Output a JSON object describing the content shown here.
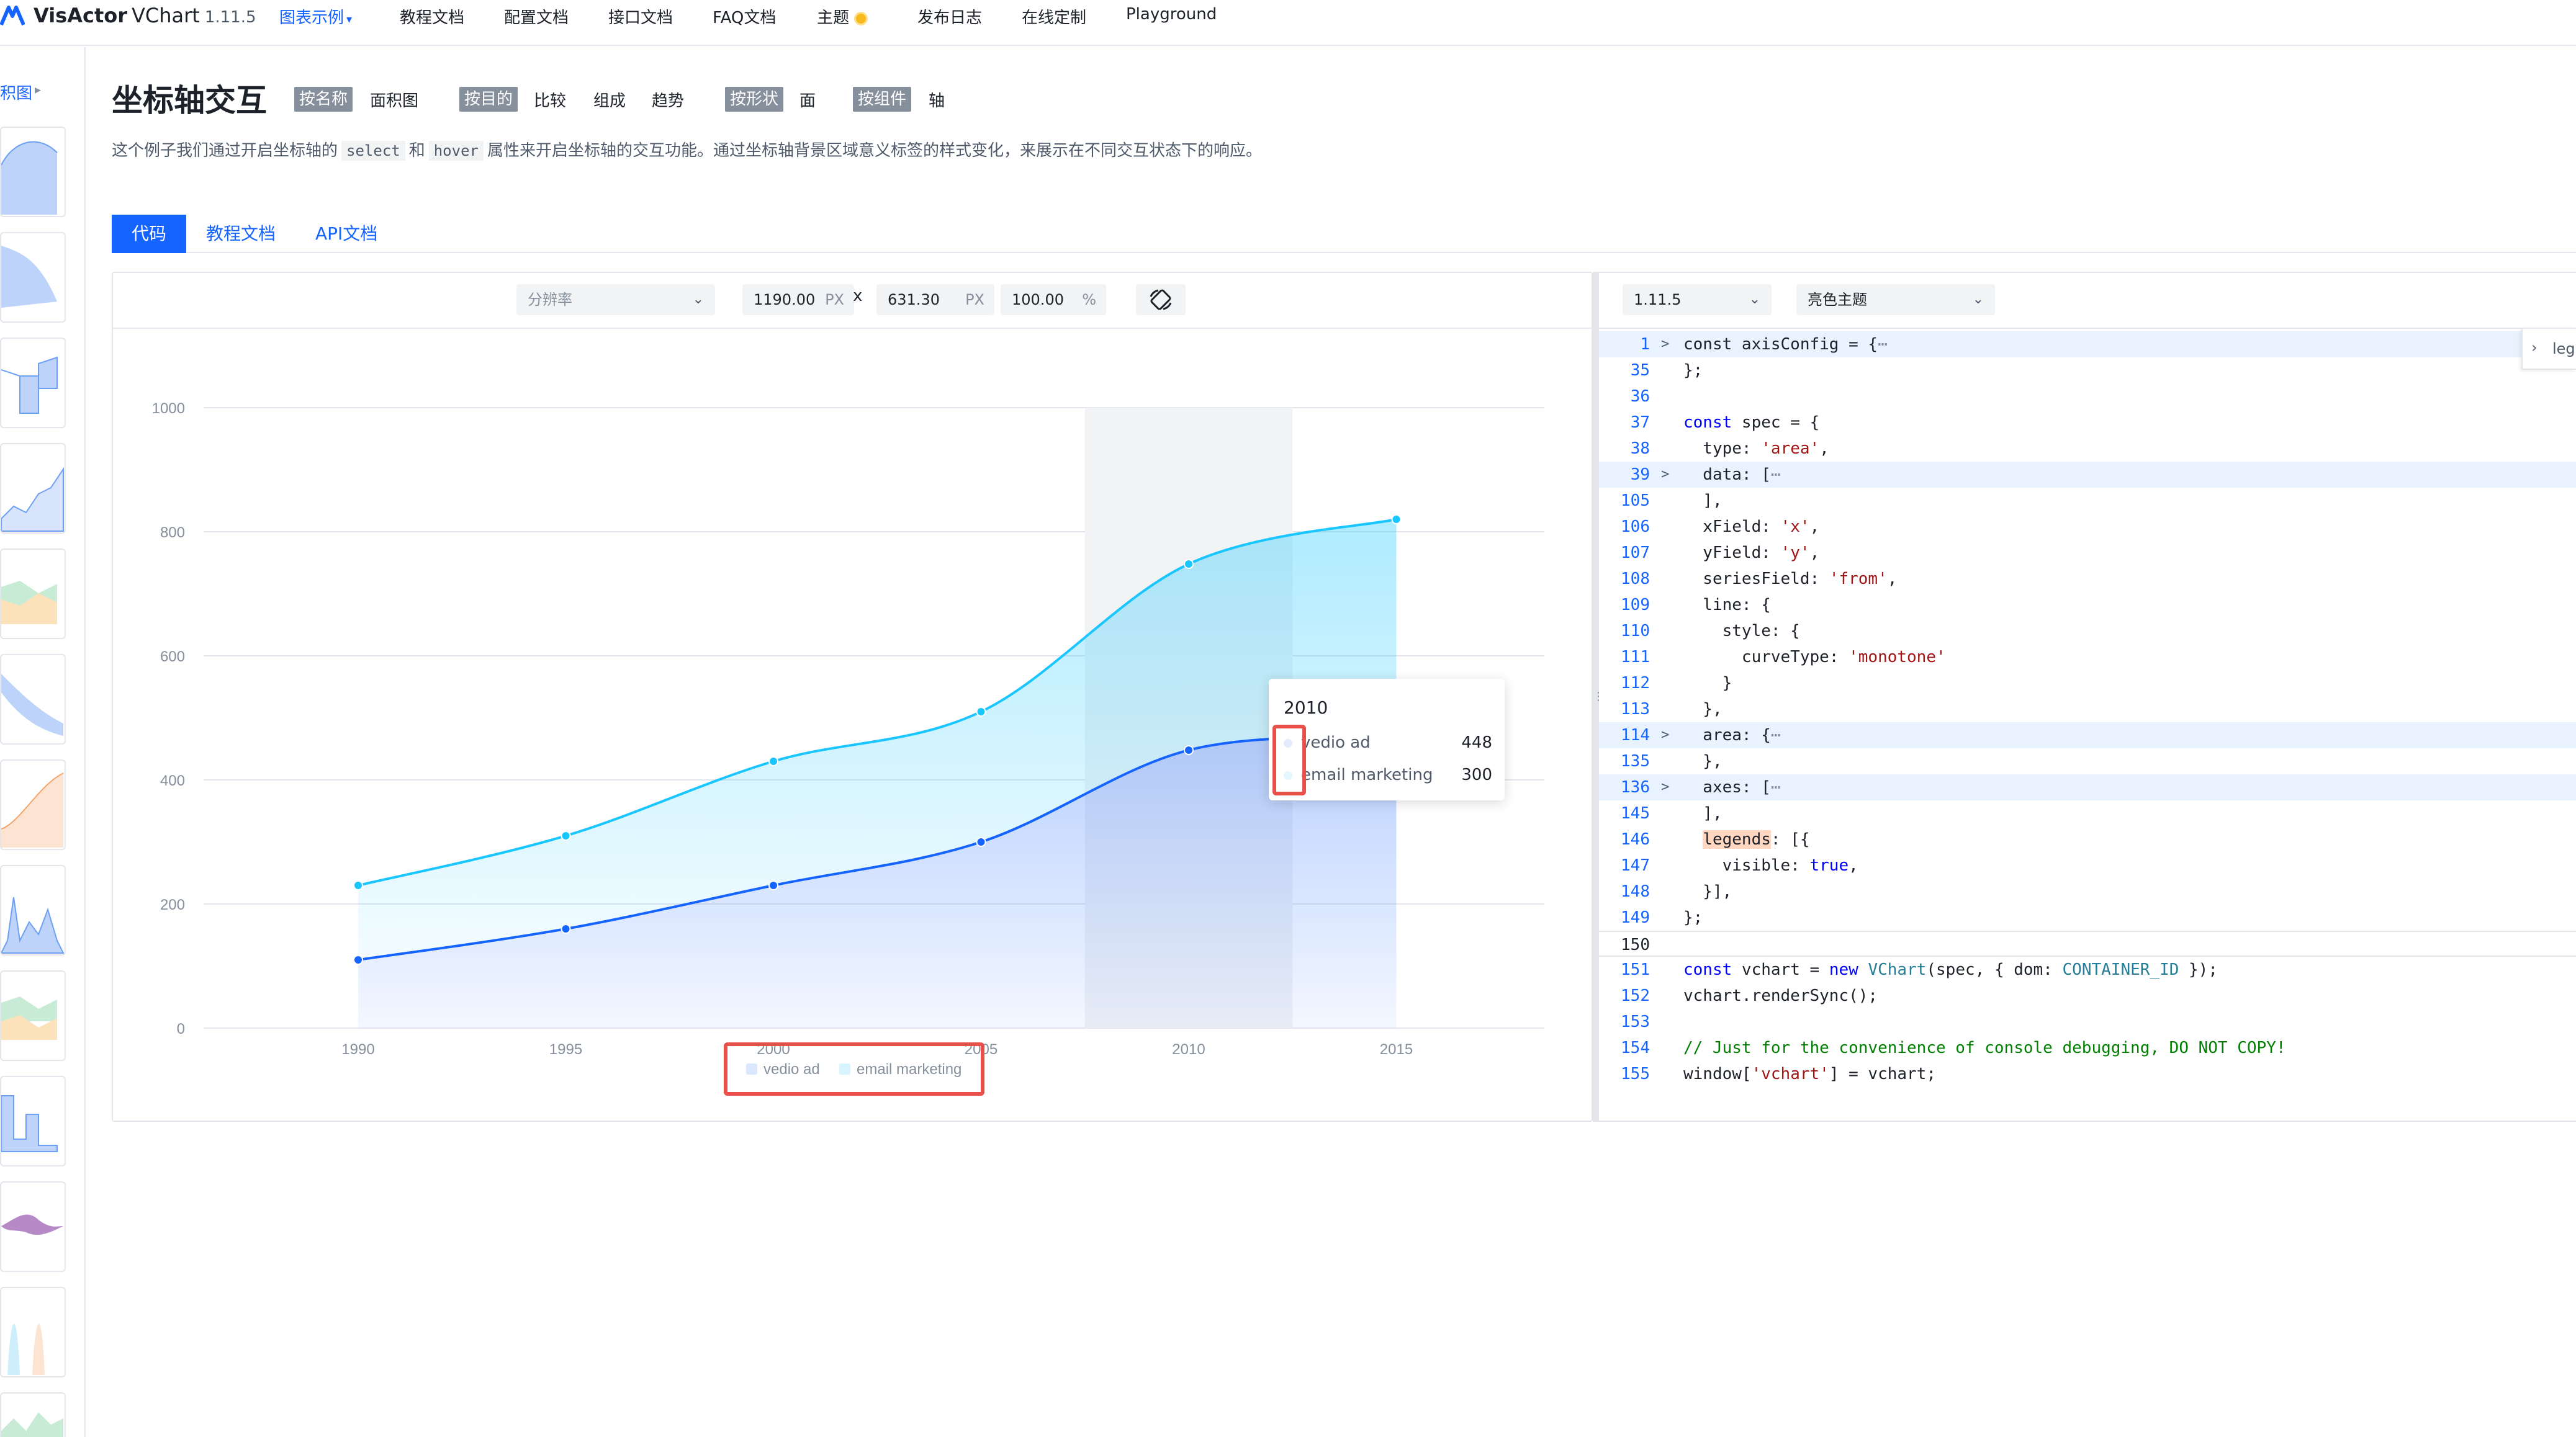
{
  "nav": {
    "brand": "VisActor",
    "product": "VChart",
    "version": "1.11.5",
    "items": [
      {
        "label": "图表示例",
        "active": true,
        "has_caret": true
      },
      {
        "label": "教程文档"
      },
      {
        "label": "配置文档"
      },
      {
        "label": "接口文档"
      },
      {
        "label": "FAQ文档"
      },
      {
        "label": "主题"
      },
      {
        "label": "发布日志"
      },
      {
        "label": "在线定制"
      },
      {
        "label": "Playground"
      }
    ]
  },
  "sidebar": {
    "category_label": "积图",
    "thumbnail_count": 13
  },
  "header": {
    "title": "坐标轴交互",
    "tags": [
      {
        "label": "按名称",
        "value": "面积图"
      },
      {
        "label": "按目的",
        "values": [
          "比较",
          "组成",
          "趋势"
        ]
      },
      {
        "label": "按形状",
        "value": "面"
      },
      {
        "label": "按组件",
        "value": "轴"
      }
    ],
    "desc_prefix": "这个例子我们通过开启坐标轴的",
    "desc_code1": "select",
    "desc_and": "和",
    "desc_code2": "hover",
    "desc_suffix": "属性来开启坐标轴的交互功能。通过坐标轴背景区域意义标签的样式变化，来展示在不同交互状态下的响应。"
  },
  "tabs": [
    {
      "label": "代码",
      "active": true
    },
    {
      "label": "教程文档"
    },
    {
      "label": "API文档"
    }
  ],
  "chart_toolbar": {
    "resolution_placeholder": "分辨率",
    "width": "1190.00",
    "height": "631.30",
    "unit": "PX",
    "x_sep": "x",
    "zoom": "100.00",
    "zoom_unit": "%"
  },
  "chart_data": {
    "type": "area",
    "categories": [
      "1990",
      "1995",
      "2000",
      "2005",
      "2010",
      "2015"
    ],
    "series": [
      {
        "name": "vedio ad",
        "values": [
          110,
          160,
          230,
          300,
          448,
          470
        ]
      },
      {
        "name": "email marketing",
        "values": [
          120,
          150,
          200,
          210,
          300,
          350
        ]
      }
    ],
    "stacked": true,
    "y_ticks": [
      "0",
      "200",
      "400",
      "600",
      "800",
      "1000"
    ],
    "ylim": [
      0,
      1000
    ],
    "grid": true,
    "legend": "bottom",
    "colors": {
      "vedio_ad": "#1664ff",
      "email_marketing": "#1ac6ff"
    },
    "hover_band_category": "2010"
  },
  "tooltip": {
    "title": "2010",
    "rows": [
      {
        "label": "vedio ad",
        "value": "448"
      },
      {
        "label": "email marketing",
        "value": "300"
      }
    ]
  },
  "code_toolbar": {
    "version": "1.11.5",
    "theme": "亮色主题"
  },
  "code_collapse_tab": "leg",
  "code": [
    {
      "n": "1",
      "fold": true,
      "hl": true,
      "html": "const axisConfig = {<span style='color:#86909c'>⋯</span>"
    },
    {
      "n": "35",
      "html": "};"
    },
    {
      "n": "36",
      "html": ""
    },
    {
      "n": "37",
      "html": "<span class='k'>const</span> spec = {"
    },
    {
      "n": "38",
      "html": "  type: <span class='s'>'area'</span>,"
    },
    {
      "n": "39",
      "fold": true,
      "hl": true,
      "html": "  data: [<span style='color:#86909c'>⋯</span>"
    },
    {
      "n": "105",
      "html": "  ],"
    },
    {
      "n": "106",
      "html": "  xField: <span class='s'>'x'</span>,"
    },
    {
      "n": "107",
      "html": "  yField: <span class='s'>'y'</span>,"
    },
    {
      "n": "108",
      "html": "  seriesField: <span class='s'>'from'</span>,"
    },
    {
      "n": "109",
      "html": "  line: {"
    },
    {
      "n": "110",
      "html": "    style: {"
    },
    {
      "n": "111",
      "html": "      curveType: <span class='s'>'monotone'</span>"
    },
    {
      "n": "112",
      "html": "    }"
    },
    {
      "n": "113",
      "html": "  },"
    },
    {
      "n": "114",
      "fold": true,
      "hl": true,
      "html": "  area: {<span style='color:#86909c'>⋯</span>"
    },
    {
      "n": "135",
      "html": "  },"
    },
    {
      "n": "136",
      "fold": true,
      "hl": true,
      "html": "  axes: [<span style='color:#86909c'>⋯</span>"
    },
    {
      "n": "145",
      "html": "  ],"
    },
    {
      "n": "146",
      "html": "  <span class='legend-hl'>legends</span>: [{"
    },
    {
      "n": "147",
      "html": "    visible: <span class='k'>true</span>,"
    },
    {
      "n": "148",
      "html": "  }],"
    },
    {
      "n": "149",
      "html": "};"
    },
    {
      "n": "150",
      "cur": true,
      "html": ""
    },
    {
      "n": "151",
      "html": "<span class='k'>const</span> vchart = <span class='k'>new</span> <span class='t'>VChart</span>(spec, { dom: <span class='t'>CONTAINER_ID</span> });"
    },
    {
      "n": "152",
      "html": "vchart.renderSync();"
    },
    {
      "n": "153",
      "html": ""
    },
    {
      "n": "154",
      "html": "<span class='c'>// Just for the convenience of console debugging, DO NOT COPY!</span>"
    },
    {
      "n": "155",
      "html": "window[<span class='s'>'vchart'</span>] = vchart;"
    }
  ]
}
